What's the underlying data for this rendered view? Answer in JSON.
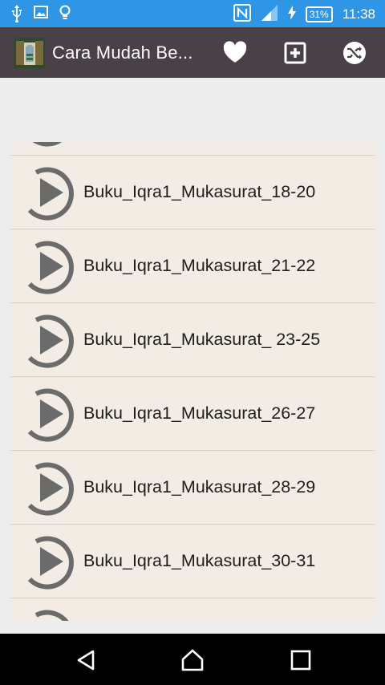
{
  "status_bar": {
    "battery": "31%",
    "time": "11:38"
  },
  "app_bar": {
    "title": "Cara Mudah Be..."
  },
  "list": {
    "items": [
      {
        "label": ""
      },
      {
        "label": "Buku_Iqra1_Mukasurat_18-20"
      },
      {
        "label": "Buku_Iqra1_Mukasurat_21-22"
      },
      {
        "label": "Buku_Iqra1_Mukasurat_ 23-25"
      },
      {
        "label": "Buku_Iqra1_Mukasurat_26-27"
      },
      {
        "label": "Buku_Iqra1_Mukasurat_28-29"
      },
      {
        "label": "Buku_Iqra1_Mukasurat_30-31"
      },
      {
        "label": ""
      }
    ]
  },
  "icons": {
    "usb": "usb-icon",
    "gallery": "image-icon",
    "bulb": "lightbulb-icon",
    "nfc": "nfc-icon",
    "signal": "signal-icon",
    "charging": "charging-icon",
    "favorite": "heart-icon",
    "add": "add-box-icon",
    "shuffle": "shuffle-icon",
    "play": "play-circle-icon",
    "back": "back-icon",
    "home": "home-icon",
    "recents": "recents-icon"
  },
  "colors": {
    "status_bar": "#2f96e5",
    "app_bar": "#4a4047",
    "row_bg": "#f2ece4",
    "icon_gray": "#6b6b6b"
  }
}
